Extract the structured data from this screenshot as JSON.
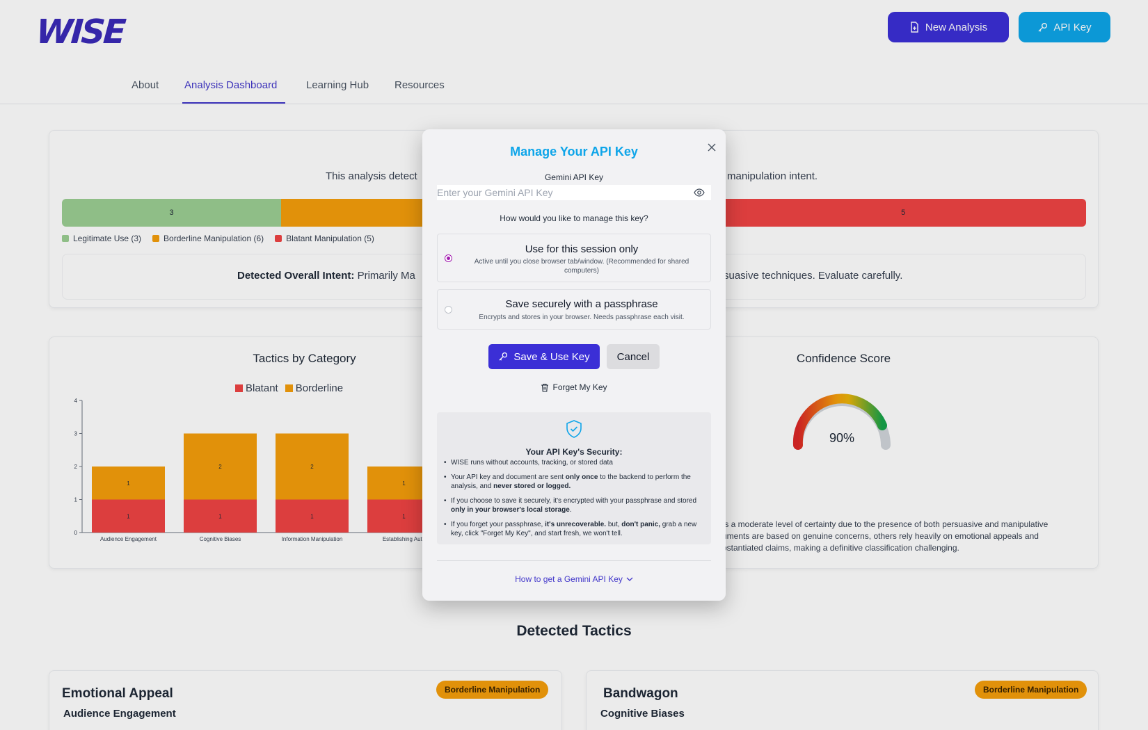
{
  "header": {
    "logo": "WISE",
    "new_analysis_label": "New Analysis",
    "api_key_label": "API Key"
  },
  "nav": {
    "items": [
      "About",
      "Analysis Dashboard",
      "Learning Hub",
      "Resources"
    ],
    "active": "Analysis Dashboard"
  },
  "summary": {
    "description_left": "This analysis detect",
    "description_right": "manipulation intent.",
    "bar": [
      {
        "label": "3",
        "color": "#9ccf93",
        "fraction": 0.214
      },
      {
        "label": "",
        "color": "#f59e0b",
        "fraction": 0.429
      },
      {
        "label": "5",
        "color": "#ef4444",
        "fraction": 0.357
      }
    ],
    "legend": [
      {
        "label": "Legitimate Use (3)",
        "color": "#9ccf93"
      },
      {
        "label": "Borderline Manipulation (6)",
        "color": "#f59e0b"
      },
      {
        "label": "Blatant Manipulation (5)",
        "color": "#ef4444"
      }
    ],
    "intent_label": "Detected Overall Intent:",
    "intent_left": "Primarily Ma",
    "intent_right": "suasive techniques. Evaluate carefully."
  },
  "tactics_chart": {
    "title": "Tactics by Category",
    "legend_blatant": "Blatant",
    "legend_borderline": "Borderline"
  },
  "chart_data": {
    "type": "bar",
    "stacked": true,
    "title": "Tactics by Category",
    "categories": [
      "Audience Engagement",
      "Cognitive Biases",
      "Information Manipulation",
      "Establishing Auth"
    ],
    "series": [
      {
        "name": "Blatant",
        "values": [
          1,
          1,
          1,
          1
        ],
        "color": "#ef4444"
      },
      {
        "name": "Borderline",
        "values": [
          1,
          2,
          2,
          1
        ],
        "color": "#f59e0b"
      }
    ],
    "ylim": [
      0,
      4
    ],
    "yticks": [
      "0",
      "1",
      "2",
      "3",
      "4"
    ]
  },
  "confidence": {
    "title": "Confidence Score",
    "value_label": "90%",
    "value": 0.9,
    "description_lines": [
      "ts a moderate level of certainty due to the presence of both persuasive and manipulative",
      "uments are based on genuine concerns, others rely heavily on emotional appeals and",
      "bstantiated claims, making a definitive classification challenging."
    ]
  },
  "detected": {
    "title": "Detected Tactics",
    "cards": [
      {
        "name": "Emotional Appeal",
        "category": "Audience Engagement",
        "badge": "Borderline Manipulation"
      },
      {
        "name": "Bandwagon",
        "category": "Cognitive Biases",
        "badge": "Borderline Manipulation"
      }
    ]
  },
  "modal": {
    "title": "Manage Your API Key",
    "field_label": "Gemini API Key",
    "input_placeholder": "Enter your Gemini API Key",
    "input_value": "",
    "question": "How would you like to manage this key?",
    "option_session_title": "Use for this session only",
    "option_session_sub": "Active until you close browser tab/window. (Recommended for shared computers)",
    "option_secure_title": "Save securely with a passphrase",
    "option_secure_sub": "Encrypts and stores in your browser. Needs passphrase each visit.",
    "selected_option": "session",
    "save_label": "Save & Use Key",
    "cancel_label": "Cancel",
    "forget_label": "Forget My Key",
    "security_title": "Your API Key's Security:",
    "howto_label": "How to get a Gemini API Key"
  }
}
